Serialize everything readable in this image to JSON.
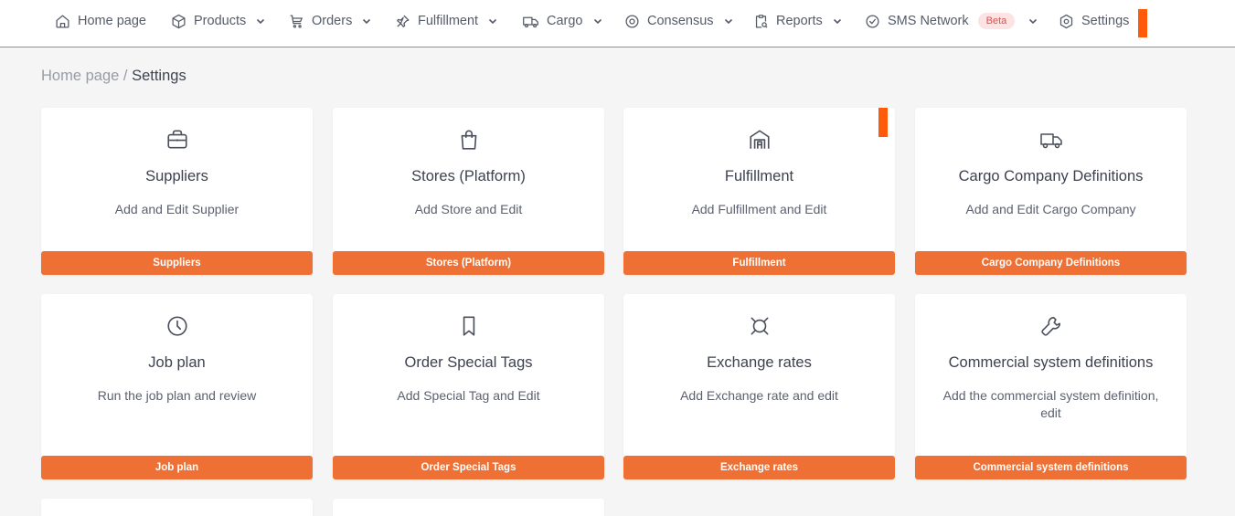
{
  "nav": {
    "items": [
      {
        "label": "Home page",
        "icon": "home-icon",
        "dropdown": false
      },
      {
        "label": "Products",
        "icon": "box-icon",
        "dropdown": true
      },
      {
        "label": "Orders",
        "icon": "cart-icon",
        "dropdown": true
      },
      {
        "label": "Fulfillment",
        "icon": "pin-icon",
        "dropdown": true
      },
      {
        "label": "Cargo",
        "icon": "truck-icon",
        "dropdown": true
      },
      {
        "label": "Consensus",
        "icon": "target-icon",
        "dropdown": true
      },
      {
        "label": "Reports",
        "icon": "report-icon",
        "dropdown": true
      },
      {
        "label": "SMS Network",
        "icon": "check-circle-icon",
        "dropdown": true,
        "badge": "Beta"
      },
      {
        "label": "Settings",
        "icon": "settings-icon",
        "dropdown": false
      }
    ]
  },
  "breadcrumb": {
    "home": "Home page",
    "separator": " / ",
    "current": "Settings"
  },
  "cards": [
    {
      "title": "Suppliers",
      "desc": "Add and Edit Supplier",
      "button": "Suppliers",
      "icon": "briefcase-icon"
    },
    {
      "title": "Stores (Platform)",
      "desc": "Add Store and Edit",
      "button": "Stores (Platform)",
      "icon": "shopping-bag-icon"
    },
    {
      "title": "Fulfillment",
      "desc": "Add Fulfillment and Edit",
      "button": "Fulfillment",
      "icon": "warehouse-icon"
    },
    {
      "title": "Cargo Company Definitions",
      "desc": "Add and Edit Cargo Company",
      "button": "Cargo Company Definitions",
      "icon": "truck-icon"
    },
    {
      "title": "Job plan",
      "desc": "Run the job plan and review",
      "button": "Job plan",
      "icon": "clock-icon"
    },
    {
      "title": "Order Special Tags",
      "desc": "Add Special Tag and Edit",
      "button": "Order Special Tags",
      "icon": "bookmark-icon"
    },
    {
      "title": "Exchange rates",
      "desc": "Add Exchange rate and edit",
      "button": "Exchange rates",
      "icon": "currency-icon"
    },
    {
      "title": "Commercial system definitions",
      "desc": "Add the commercial system definition, edit",
      "button": "Commercial system definitions",
      "icon": "wrench-icon"
    }
  ],
  "colors": {
    "accent": "#ef7034",
    "marker": "#ff5a0a",
    "background": "#f5f5f6",
    "badge_bg": "#fde3e3",
    "badge_text": "#d9534f"
  }
}
